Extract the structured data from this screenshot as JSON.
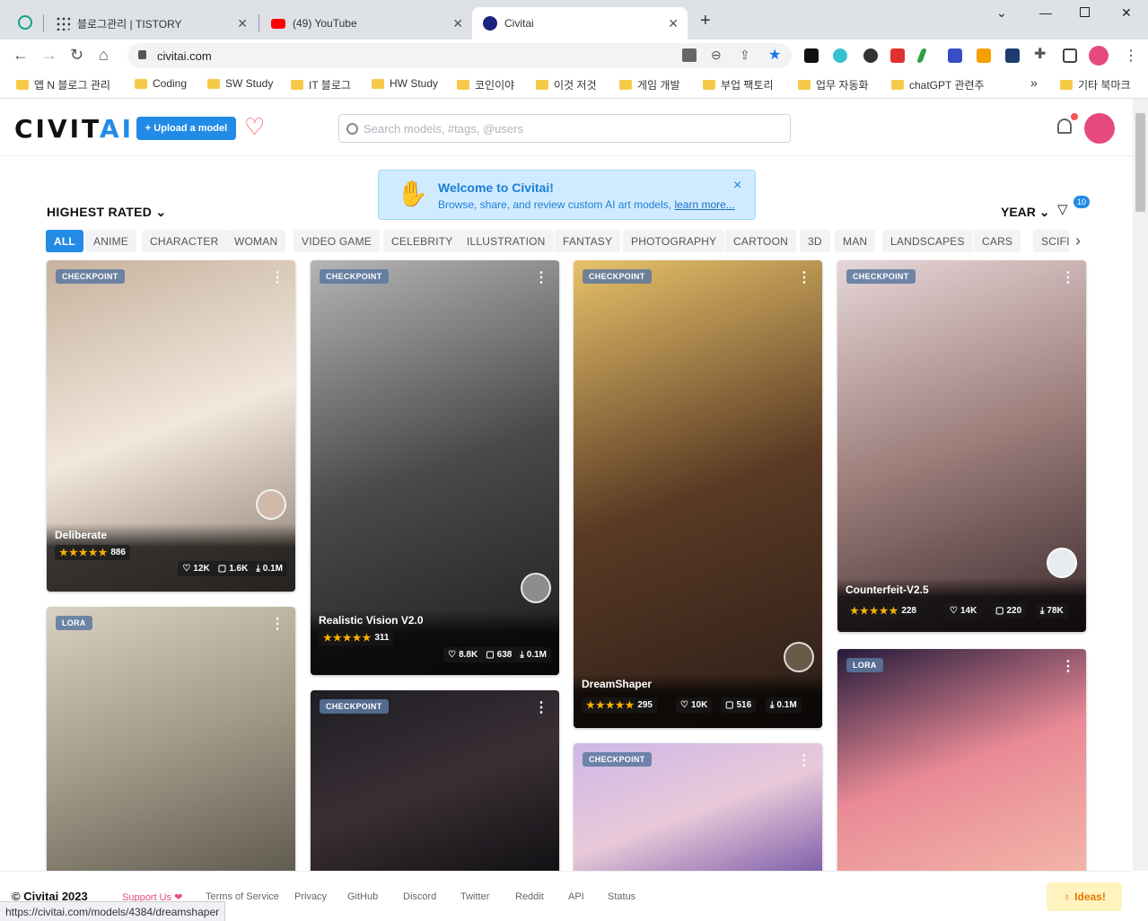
{
  "browser": {
    "tabs": [
      {
        "title": "블로그관리 | TISTORY"
      },
      {
        "title": "(49) YouTube"
      },
      {
        "title": "Civitai"
      }
    ],
    "new_tab": "+",
    "url": "civitai.com",
    "bookmarks": [
      "앱 N 블로그 관리",
      "Coding",
      "SW Study",
      "IT 블로그",
      "HW Study",
      "코인이야",
      "이것 저것",
      "게임 개발",
      "부업 팩토리",
      "업무 자동화",
      "chatGPT 관련주"
    ],
    "bookmarks_more": "»",
    "other_bookmarks": "기타 북마크",
    "status_url": "https://civitai.com/models/4384/dreamshaper"
  },
  "header": {
    "logo_main": "CIVIT",
    "logo_ai": "AI",
    "upload_label": "+ Upload a model",
    "search_placeholder": "Search models, #tags, @users"
  },
  "welcome": {
    "title": "Welcome to Civitai!",
    "desc": "Browse, share, and review custom AI art models,",
    "link": "learn more...",
    "close": "×"
  },
  "filters": {
    "sort": "HIGHEST RATED",
    "period": "YEAR",
    "filter_count": "10",
    "chips": [
      "ALL",
      "ANIME",
      "CHARACTER",
      "WOMAN",
      "VIDEO GAME",
      "CELEBRITY",
      "ILLUSTRATION",
      "FANTASY",
      "PHOTOGRAPHY",
      "CARTOON",
      "3D",
      "MAN",
      "LANDSCAPES",
      "CARS",
      "SCIFI"
    ],
    "active_chip": "ALL",
    "more": "›"
  },
  "cards": [
    {
      "type": "CHECKPOINT",
      "name": "Deliberate",
      "stars": "★★★★★",
      "rating_count": "886",
      "likes": "12K",
      "comments": "1.6K",
      "downloads": "0.1M",
      "rating": 5,
      "colors": [
        "#c6b29d",
        "#f2e7dc",
        "#8a7b70"
      ]
    },
    {
      "type": "CHECKPOINT",
      "name": "Realistic Vision V2.0",
      "stars": "★★★★★",
      "rating_count": "311",
      "likes": "8.8K",
      "comments": "638",
      "downloads": "0.1M",
      "rating": 5,
      "colors": [
        "#b5b5b5",
        "#4a4a4a",
        "#1c1c1c"
      ]
    },
    {
      "type": "CHECKPOINT",
      "name": "DreamShaper",
      "stars": "★★★★★",
      "rating_count": "295",
      "likes": "10K",
      "comments": "516",
      "downloads": "0.1M",
      "rating": 5,
      "colors": [
        "#e8c26a",
        "#5a3a24",
        "#2a1c18"
      ]
    },
    {
      "type": "CHECKPOINT",
      "name": "Counterfeit-V2.5",
      "stars": "★★★★★",
      "rating_count": "228",
      "likes": "14K",
      "comments": "220",
      "downloads": "78K",
      "rating": 5,
      "colors": [
        "#e7d6d8",
        "#9c7e7a",
        "#3b2a2e"
      ]
    },
    {
      "type": "LORA",
      "colors": [
        "#d9d1c1",
        "#a39a88",
        "#5f5a4f"
      ]
    },
    {
      "type": "CHECKPOINT",
      "colors": [
        "#1e1e24",
        "#3a2f35",
        "#0f0f12"
      ]
    },
    {
      "type": "CHECKPOINT",
      "colors": [
        "#cdb7e8",
        "#e9c9d9",
        "#7a5aa8"
      ]
    },
    {
      "type": "LORA",
      "colors": [
        "#241a3a",
        "#e98a96",
        "#f3b6a8"
      ]
    }
  ],
  "footer": {
    "copyright": "© Civitai 2023",
    "support": "Support Us ❤",
    "links": [
      "Terms of Service",
      "Privacy",
      "GitHub",
      "Discord",
      "Twitter",
      "Reddit",
      "API",
      "Status"
    ],
    "ideas": "Ideas!"
  }
}
